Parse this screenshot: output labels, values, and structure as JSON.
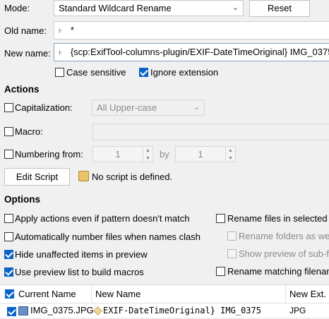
{
  "mode": {
    "label": "Mode:",
    "value": "Standard Wildcard Rename",
    "reset": "Reset"
  },
  "old_name": {
    "label": "Old name:",
    "value": "*"
  },
  "new_name": {
    "label": "New name:",
    "value": "{scp:ExifTool-columns-plugin/EXIF-DateTimeOriginal} IMG_0375"
  },
  "options_top": {
    "case_sensitive": "Case sensitive",
    "case_checked": false,
    "ignore_extension": "Ignore extension",
    "ignore_checked": true
  },
  "actions": {
    "heading": "Actions",
    "capitalization": {
      "label": "Capitalization:",
      "checked": false,
      "value": "All Upper-case"
    },
    "macro": {
      "label": "Macro:",
      "checked": false,
      "value": ""
    },
    "numbering": {
      "label": "Numbering from:",
      "checked": false,
      "from": "1",
      "by_label": "by",
      "by": "1"
    },
    "edit_script": "Edit Script",
    "no_script": "No script is defined."
  },
  "options": {
    "heading": "Options",
    "left": [
      {
        "label": "Apply actions even if pattern doesn't match",
        "checked": false
      },
      {
        "label": "Automatically number files when names clash",
        "checked": false
      },
      {
        "label": "Hide unaffected items in preview",
        "checked": true
      },
      {
        "label": "Use preview list to build macros",
        "checked": true
      }
    ],
    "right": [
      {
        "label": "Rename files in selected",
        "checked": false,
        "disabled": false
      },
      {
        "label": "Rename folders as we",
        "checked": false,
        "disabled": true
      },
      {
        "label": "Show preview of sub-f",
        "checked": false,
        "disabled": true
      },
      {
        "label": "Rename matching filenan",
        "checked": false,
        "disabled": false
      }
    ]
  },
  "preview": {
    "columns": [
      "Current Name",
      "New Name",
      "New Ext."
    ],
    "rows": [
      {
        "checked": true,
        "current": "IMG_0375.JPG",
        "new_name": "EXIF-DateTimeOriginal} IMG_0375",
        "new_ext": "JPG"
      }
    ]
  }
}
